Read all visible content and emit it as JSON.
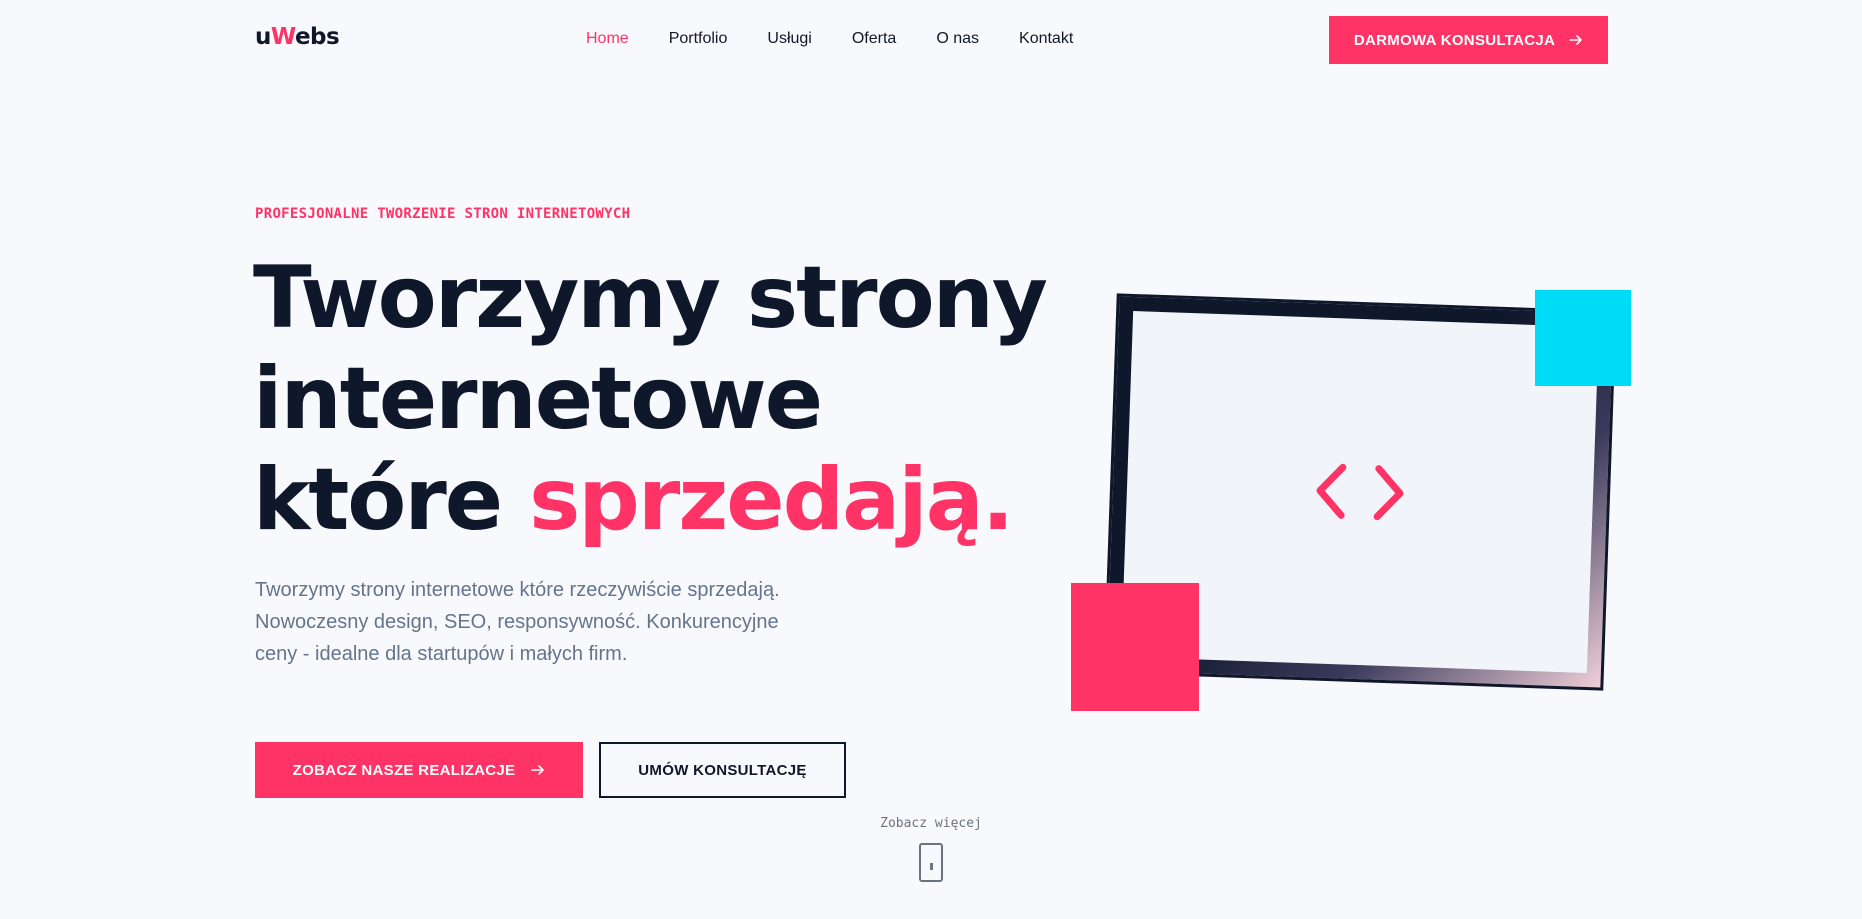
{
  "header": {
    "logo": {
      "prefix": "u",
      "accent": "W",
      "suffix": "ebs"
    },
    "nav": [
      {
        "label": "Home",
        "active": true
      },
      {
        "label": "Portfolio",
        "active": false
      },
      {
        "label": "Usługi",
        "active": false
      },
      {
        "label": "Oferta",
        "active": false
      },
      {
        "label": "O nas",
        "active": false
      },
      {
        "label": "Kontakt",
        "active": false
      }
    ],
    "cta_label": "DARMOWA KONSULTACJA",
    "cta_icon": "arrow-right-icon"
  },
  "hero": {
    "eyebrow": "PROFESJONALNE TWORZENIE STRON INTERNETOWYCH",
    "headline_line1": "Tworzymy strony",
    "headline_line2": "internetowe",
    "headline_line3_plain": "które ",
    "headline_line3_accent": "sprzedają.",
    "description": "Tworzymy strony internetowe które rzeczywiście sprzedają. Nowoczesny design, SEO, responsywność. Konkurencyjne ceny - idealne dla startupów i małych firm.",
    "primary_button": "ZOBACZ NASZE REALIZACJE",
    "secondary_button": "UMÓW KONSULTACJĘ",
    "scroll_label": "Zobacz więcej"
  },
  "illustration": {
    "icon": "code-brackets-icon"
  },
  "colors": {
    "accent": "#ff3366",
    "dark": "#0f172a",
    "cyan": "#00dcf8",
    "background": "#f8f9fc",
    "muted": "#64748b"
  }
}
